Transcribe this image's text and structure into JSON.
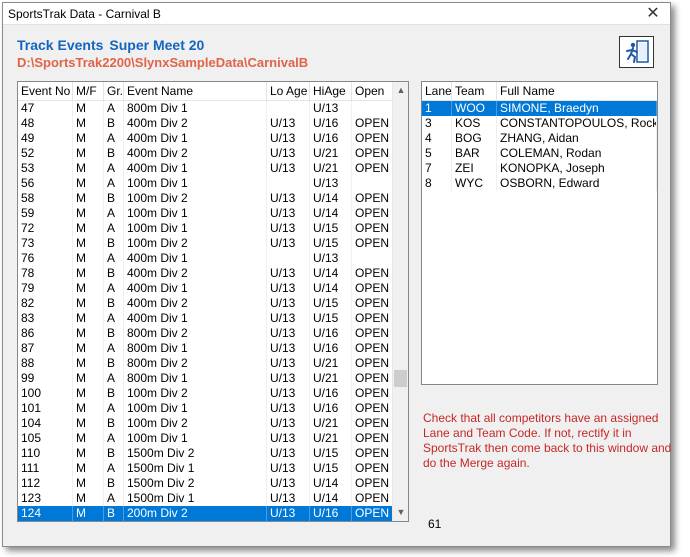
{
  "window": {
    "title": "SportsTrak Data - Carnival B",
    "close_glyph": "✕"
  },
  "heading": {
    "part1": "Track Events",
    "part2": "Super Meet 20",
    "path": "D:\\SportsTrak2200\\SlynxSampleData\\CarnivalB"
  },
  "events": {
    "columns": [
      "Event No",
      "M/F",
      "Gr.",
      "Event Name",
      "Lo Age",
      "HiAge",
      "Open"
    ],
    "rows": [
      [
        "47",
        "M",
        "A",
        "800m Div 1",
        "",
        "U/13",
        ""
      ],
      [
        "48",
        "M",
        "B",
        "400m Div 2",
        "U/13",
        "U/16",
        "OPEN"
      ],
      [
        "49",
        "M",
        "A",
        "400m Div 1",
        "U/13",
        "U/16",
        "OPEN"
      ],
      [
        "52",
        "M",
        "B",
        "400m Div 2",
        "U/13",
        "U/21",
        "OPEN"
      ],
      [
        "53",
        "M",
        "A",
        "400m Div 1",
        "U/13",
        "U/21",
        "OPEN"
      ],
      [
        "56",
        "M",
        "A",
        "100m Div 1",
        "",
        "U/13",
        ""
      ],
      [
        "58",
        "M",
        "B",
        "100m Div 2",
        "U/13",
        "U/14",
        "OPEN"
      ],
      [
        "59",
        "M",
        "A",
        "100m Div 1",
        "U/13",
        "U/14",
        "OPEN"
      ],
      [
        "72",
        "M",
        "A",
        "100m Div 1",
        "U/13",
        "U/15",
        "OPEN"
      ],
      [
        "73",
        "M",
        "B",
        "100m Div 2",
        "U/13",
        "U/15",
        "OPEN"
      ],
      [
        "76",
        "M",
        "A",
        "400m Div 1",
        "",
        "U/13",
        ""
      ],
      [
        "78",
        "M",
        "B",
        "400m Div 2",
        "U/13",
        "U/14",
        "OPEN"
      ],
      [
        "79",
        "M",
        "A",
        "400m Div 1",
        "U/13",
        "U/14",
        "OPEN"
      ],
      [
        "82",
        "M",
        "B",
        "400m Div 2",
        "U/13",
        "U/15",
        "OPEN"
      ],
      [
        "83",
        "M",
        "A",
        "400m Div 1",
        "U/13",
        "U/15",
        "OPEN"
      ],
      [
        "86",
        "M",
        "B",
        "800m Div 2",
        "U/13",
        "U/16",
        "OPEN"
      ],
      [
        "87",
        "M",
        "A",
        "800m Div 1",
        "U/13",
        "U/16",
        "OPEN"
      ],
      [
        "88",
        "M",
        "B",
        "800m Div 2",
        "U/13",
        "U/21",
        "OPEN"
      ],
      [
        "99",
        "M",
        "A",
        "800m Div 1",
        "U/13",
        "U/21",
        "OPEN"
      ],
      [
        "100",
        "M",
        "B",
        "100m Div 2",
        "U/13",
        "U/16",
        "OPEN"
      ],
      [
        "101",
        "M",
        "A",
        "100m Div 1",
        "U/13",
        "U/16",
        "OPEN"
      ],
      [
        "104",
        "M",
        "B",
        "100m Div 2",
        "U/13",
        "U/21",
        "OPEN"
      ],
      [
        "105",
        "M",
        "A",
        "100m Div 1",
        "U/13",
        "U/21",
        "OPEN"
      ],
      [
        "110",
        "M",
        "B",
        "1500m Div 2",
        "U/13",
        "U/15",
        "OPEN"
      ],
      [
        "111",
        "M",
        "A",
        "1500m Div 1",
        "U/13",
        "U/15",
        "OPEN"
      ],
      [
        "112",
        "M",
        "B",
        "1500m Div 2",
        "U/13",
        "U/14",
        "OPEN"
      ],
      [
        "123",
        "M",
        "A",
        "1500m Div 1",
        "U/13",
        "U/14",
        "OPEN"
      ],
      [
        "124",
        "M",
        "B",
        "200m Div 2",
        "U/13",
        "U/16",
        "OPEN"
      ]
    ],
    "selected_index": 27,
    "scroll_up": "▲",
    "scroll_down": "▼"
  },
  "lanes": {
    "columns": [
      "Lane",
      "Team",
      "Full Name"
    ],
    "rows": [
      [
        "1",
        "WOO",
        "SIMONE, Braedyn"
      ],
      [
        "3",
        "KOS",
        "CONSTANTOPOULOS, Rocky"
      ],
      [
        "4",
        "BOG",
        "ZHANG, Aidan"
      ],
      [
        "5",
        "BAR",
        "COLEMAN, Rodan"
      ],
      [
        "7",
        "ZEI",
        "KONOPKA, Joseph"
      ],
      [
        "8",
        "WYC",
        "OSBORN, Edward"
      ]
    ],
    "selected_index": 0
  },
  "note": "Check that all competitors have an assigned Lane and Team Code.  If not, rectify it in SportsTrak then come back to this window and do the Merge again.",
  "count": "61",
  "colors": {
    "heading_blue": "#1565c0",
    "path_orange": "#e0644a",
    "note_red": "#c62828",
    "selection": "#0078d7"
  },
  "icons": {
    "exit_button": "exit-running-man-icon"
  }
}
